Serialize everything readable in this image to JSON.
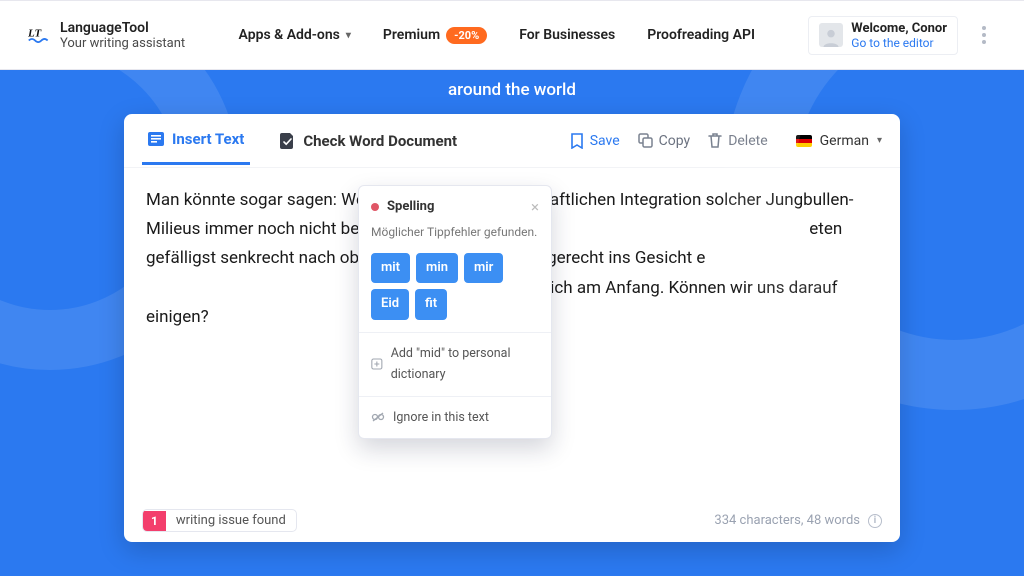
{
  "header": {
    "brand_name": "LanguageTool",
    "brand_tagline": "Your writing assistant",
    "nav": {
      "apps": "Apps & Add-ons",
      "premium": "Premium",
      "premium_badge": "-20%",
      "business": "For Businesses",
      "api": "Proofreading API"
    },
    "user": {
      "welcome": "Welcome, Conor",
      "editor_link": "Go to the editor"
    }
  },
  "hero": {
    "subtitle": "around the world"
  },
  "card": {
    "tabs": {
      "insert": "Insert Text",
      "check_doc": "Check Word Document"
    },
    "actions": {
      "save": "Save",
      "copy": "Copy",
      "delete": "Delete"
    },
    "language": "German",
    "text": {
      "pre": "Man könnte sogar sagen: Wenn wir ",
      "error_word": "mid",
      "post_a": " der gesellschaftlichen Integration solcher Jungbullen-Milieus immer noch nicht bei dem Punkt angelang",
      "post_b": "eten gefälligst senkrecht nach oben schießt und nicht waagerecht ins Gesicht e",
      "post_c": "wir noch ziemlich am Anfang. Können wir uns darauf einigen?"
    },
    "popover": {
      "category": "Spelling",
      "message": "Möglicher Tippfehler gefunden.",
      "suggestions": [
        "mit",
        "min",
        "mir",
        "Eid",
        "fit"
      ],
      "add_dict": "Add \"mid\" to personal dictionary",
      "ignore": "Ignore in this text"
    },
    "footer": {
      "issues_count": "1",
      "issues_text": "writing issue found",
      "stats": "334 characters,  48 words"
    }
  }
}
